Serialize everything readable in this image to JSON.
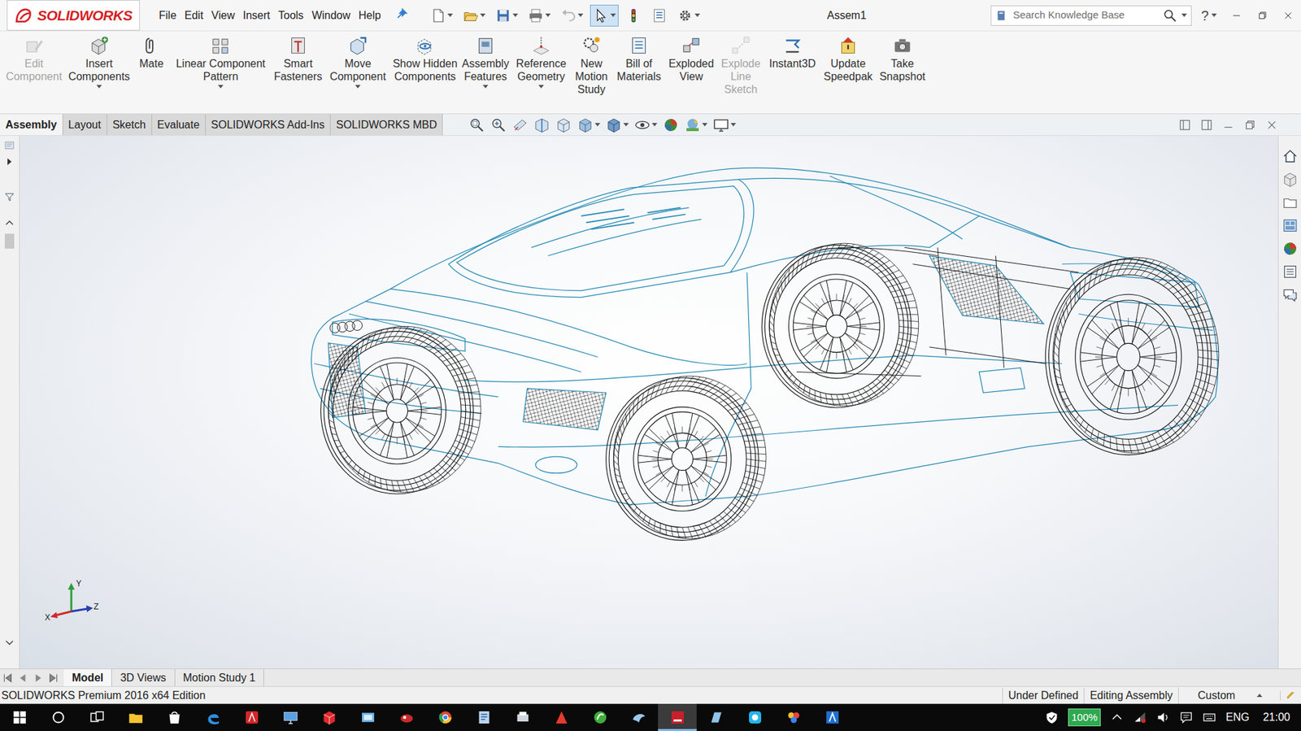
{
  "window": {
    "title": "Assem1"
  },
  "app": {
    "logo": "SOLIDWORKS"
  },
  "menu": [
    "File",
    "Edit",
    "View",
    "Insert",
    "Tools",
    "Window",
    "Help"
  ],
  "quick_tools": [
    {
      "active": false,
      "disabled": false
    },
    {
      "active": false,
      "disabled": false
    },
    {
      "active": false,
      "disabled": false
    },
    {
      "active": false,
      "disabled": false
    },
    {
      "active": false,
      "disabled": true
    },
    {
      "active": true,
      "disabled": false
    },
    {
      "active": false,
      "disabled": false
    },
    {
      "active": false,
      "disabled": false
    },
    {
      "active": false,
      "disabled": false
    }
  ],
  "search": {
    "placeholder": "Search Knowledge Base"
  },
  "help": "?",
  "ribbon": [
    {
      "label": "Edit Component",
      "disabled": true,
      "dropdown": false
    },
    {
      "label": "Insert Components",
      "disabled": false,
      "dropdown": true
    },
    {
      "label": "Mate",
      "disabled": false,
      "dropdown": false
    },
    {
      "label": "Linear Component Pattern",
      "disabled": false,
      "dropdown": true
    },
    {
      "label": "Smart Fasteners",
      "disabled": false,
      "dropdown": false
    },
    {
      "label": "Move Component",
      "disabled": false,
      "dropdown": true
    },
    {
      "label": "Show Hidden Components",
      "disabled": false,
      "dropdown": false
    },
    {
      "label": "Assembly Features",
      "disabled": false,
      "dropdown": true
    },
    {
      "label": "Reference Geometry",
      "disabled": false,
      "dropdown": true
    },
    {
      "label": "New Motion Study",
      "disabled": false,
      "dropdown": false
    },
    {
      "label": "Bill of Materials",
      "disabled": false,
      "dropdown": false
    },
    {
      "label": "Exploded View",
      "disabled": false,
      "dropdown": false
    },
    {
      "label": "Explode Line Sketch",
      "disabled": true,
      "dropdown": false
    },
    {
      "label": "Instant3D",
      "disabled": false,
      "dropdown": false
    },
    {
      "label": "Update Speedpak",
      "disabled": false,
      "dropdown": false
    },
    {
      "label": "Take Snapshot",
      "disabled": false,
      "dropdown": false
    }
  ],
  "tabs": [
    {
      "label": "Assembly",
      "selected": true
    },
    {
      "label": "Layout",
      "selected": false
    },
    {
      "label": "Sketch",
      "selected": false
    },
    {
      "label": "Evaluate",
      "selected": false
    },
    {
      "label": "SOLIDWORKS Add-Ins",
      "selected": false
    },
    {
      "label": "SOLIDWORKS MBD",
      "selected": false
    }
  ],
  "triad": {
    "y": "Y",
    "x": "X",
    "z": "Z"
  },
  "bottom_tabs": [
    {
      "label": "Model",
      "selected": true
    },
    {
      "label": "3D Views",
      "selected": false
    },
    {
      "label": "Motion Study 1",
      "selected": false
    }
  ],
  "status_bar": {
    "edition": "SOLIDWORKS Premium 2016 x64 Edition",
    "items": [
      "Under Defined",
      "Editing Assembly",
      "Custom"
    ]
  },
  "taskbar": {
    "apps": [
      {
        "active": false
      },
      {
        "active": false
      },
      {
        "active": false
      },
      {
        "active": false
      },
      {
        "active": false
      },
      {
        "active": false
      },
      {
        "active": false
      },
      {
        "active": false
      },
      {
        "active": false
      },
      {
        "active": false
      },
      {
        "active": false
      },
      {
        "active": false
      },
      {
        "active": false
      },
      {
        "active": false
      },
      {
        "active": true
      },
      {
        "active": false
      },
      {
        "active": false
      },
      {
        "active": false
      },
      {
        "active": false
      }
    ],
    "battery": "100%",
    "language": "ENG",
    "time": "21:00"
  }
}
